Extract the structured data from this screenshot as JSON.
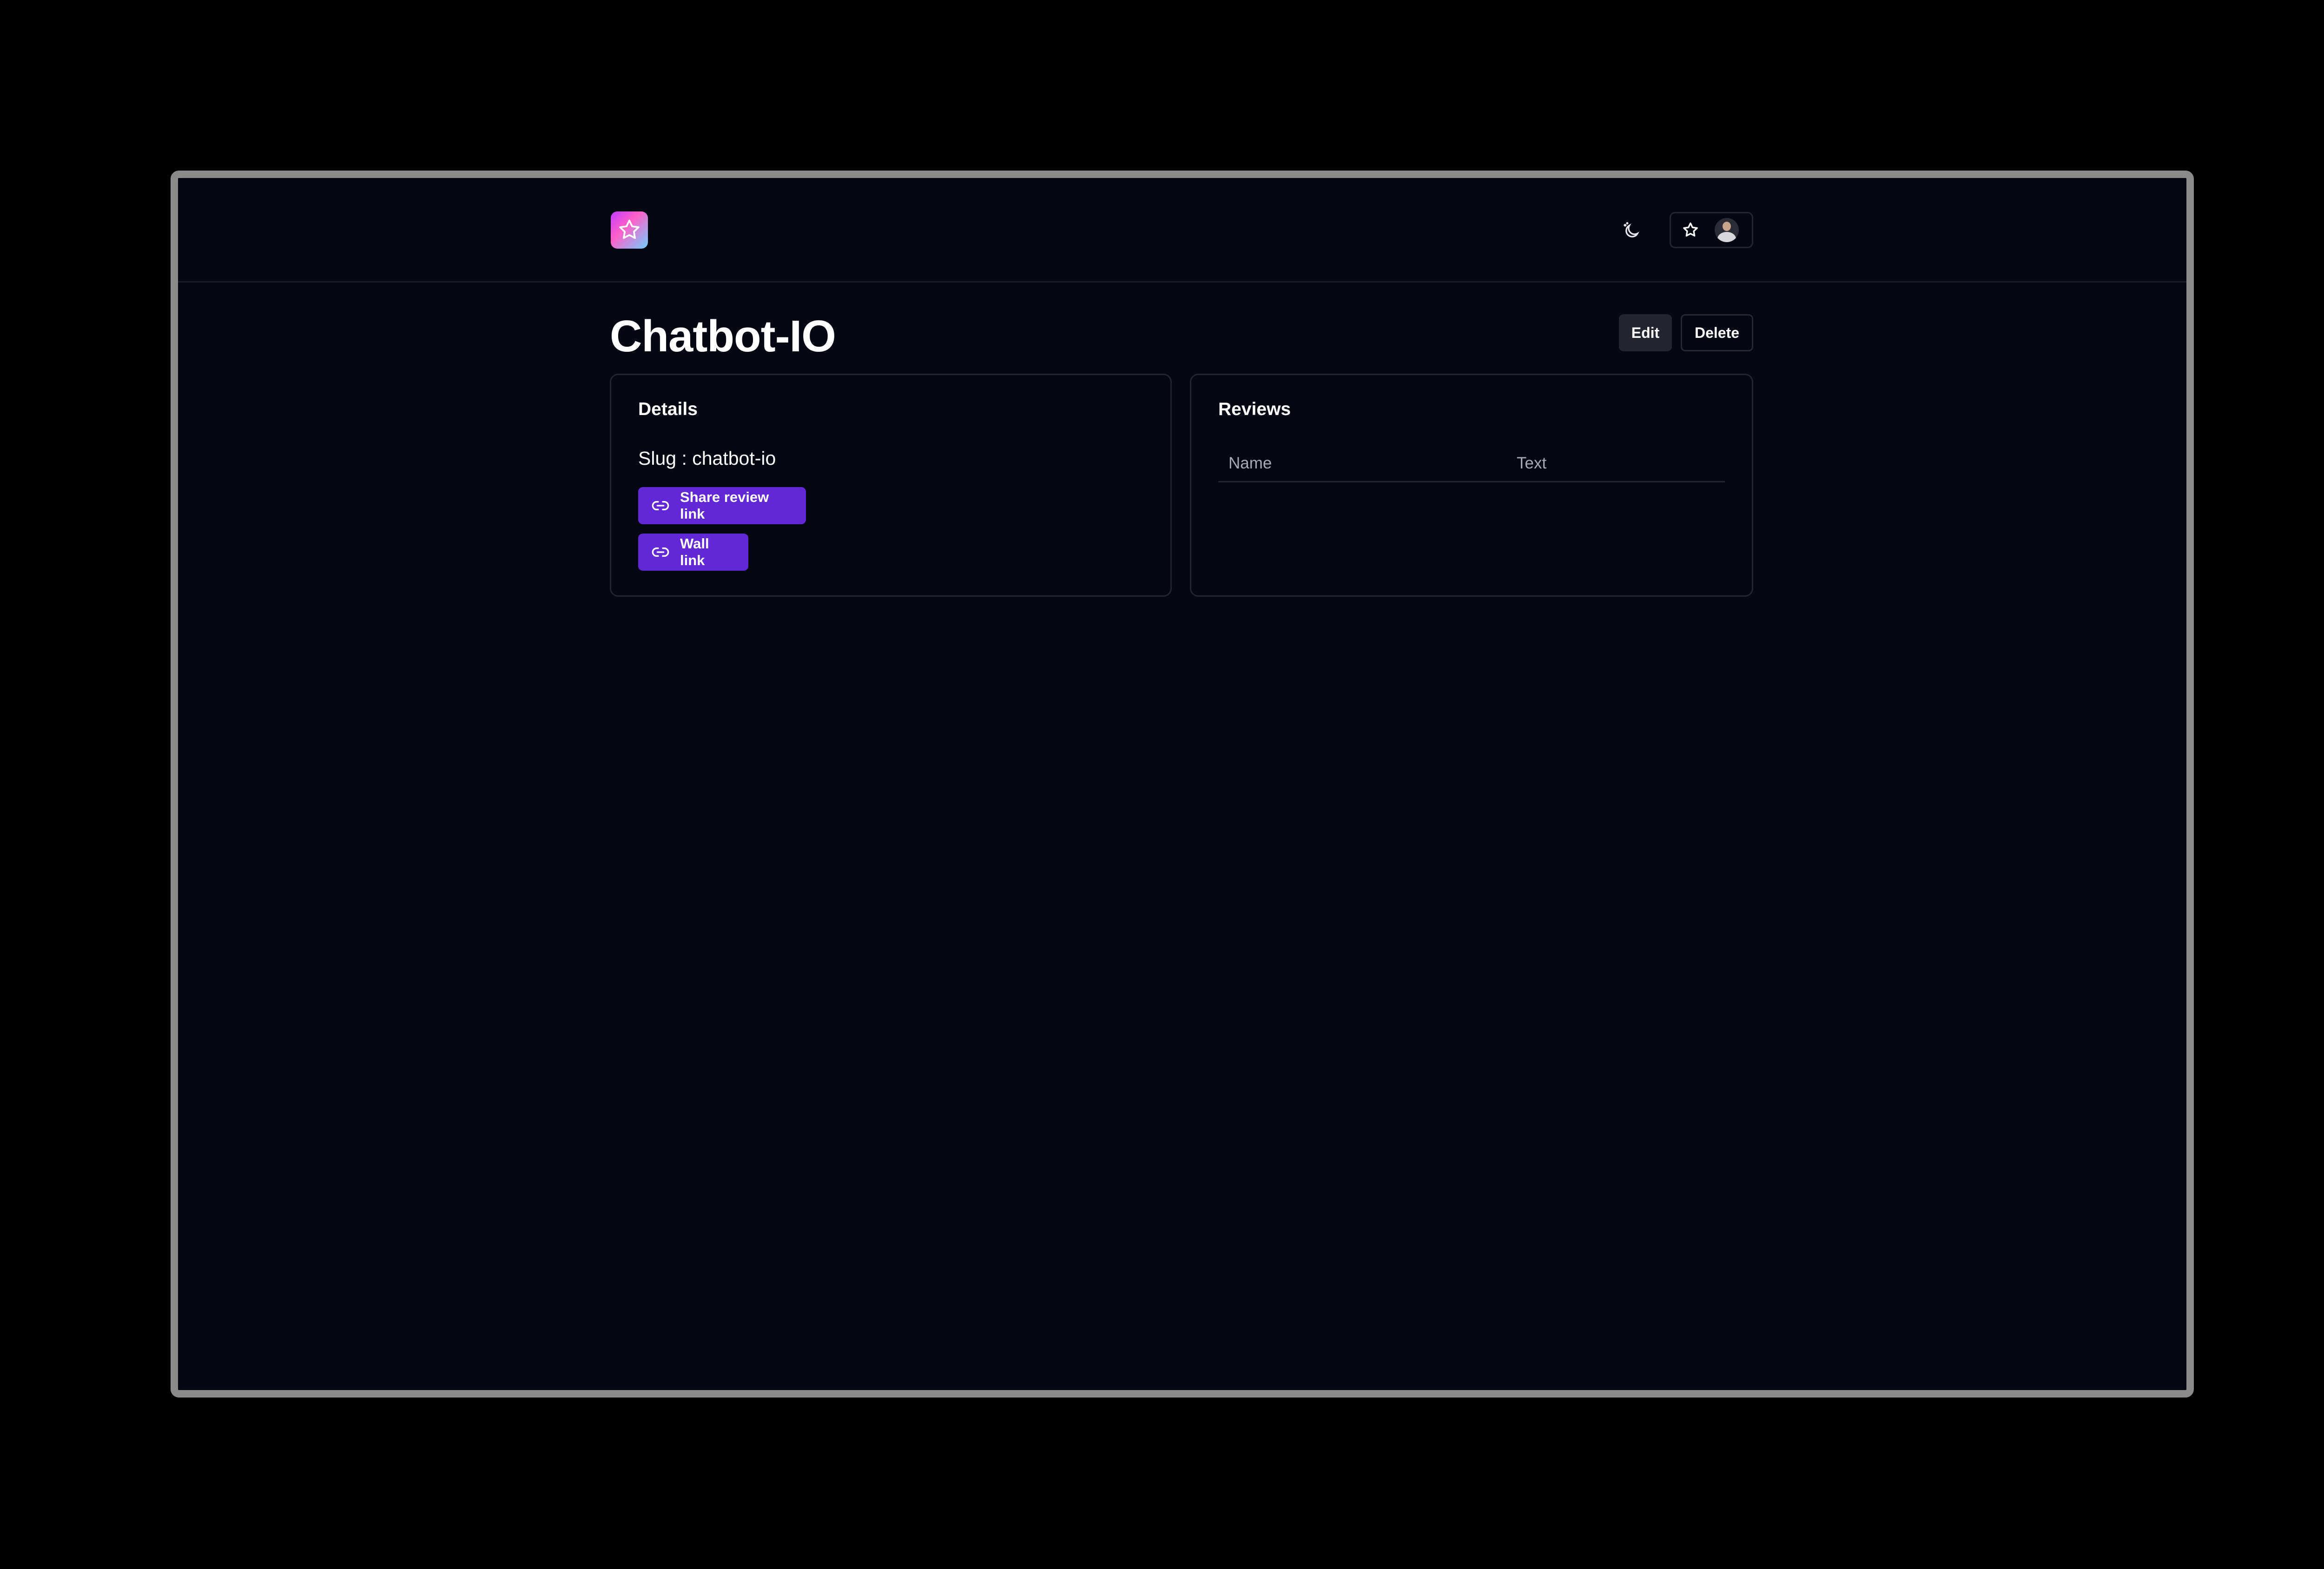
{
  "header": {
    "logo_icon": "star-icon",
    "theme_toggle_icon": "moon-sun-icon",
    "user_menu_icon": "star-icon"
  },
  "page": {
    "title": "Chatbot-IO",
    "edit_label": "Edit",
    "delete_label": "Delete"
  },
  "details": {
    "title": "Details",
    "slug_text": "Slug : chatbot-io",
    "share_link_label": "Share review link",
    "wall_link_label": "Wall link",
    "link_icon": "link-icon"
  },
  "reviews": {
    "title": "Reviews",
    "columns": [
      "Name",
      "Text"
    ],
    "rows": []
  },
  "colors": {
    "background": "#050713",
    "accent": "#6328d6",
    "border": "#22252f"
  }
}
